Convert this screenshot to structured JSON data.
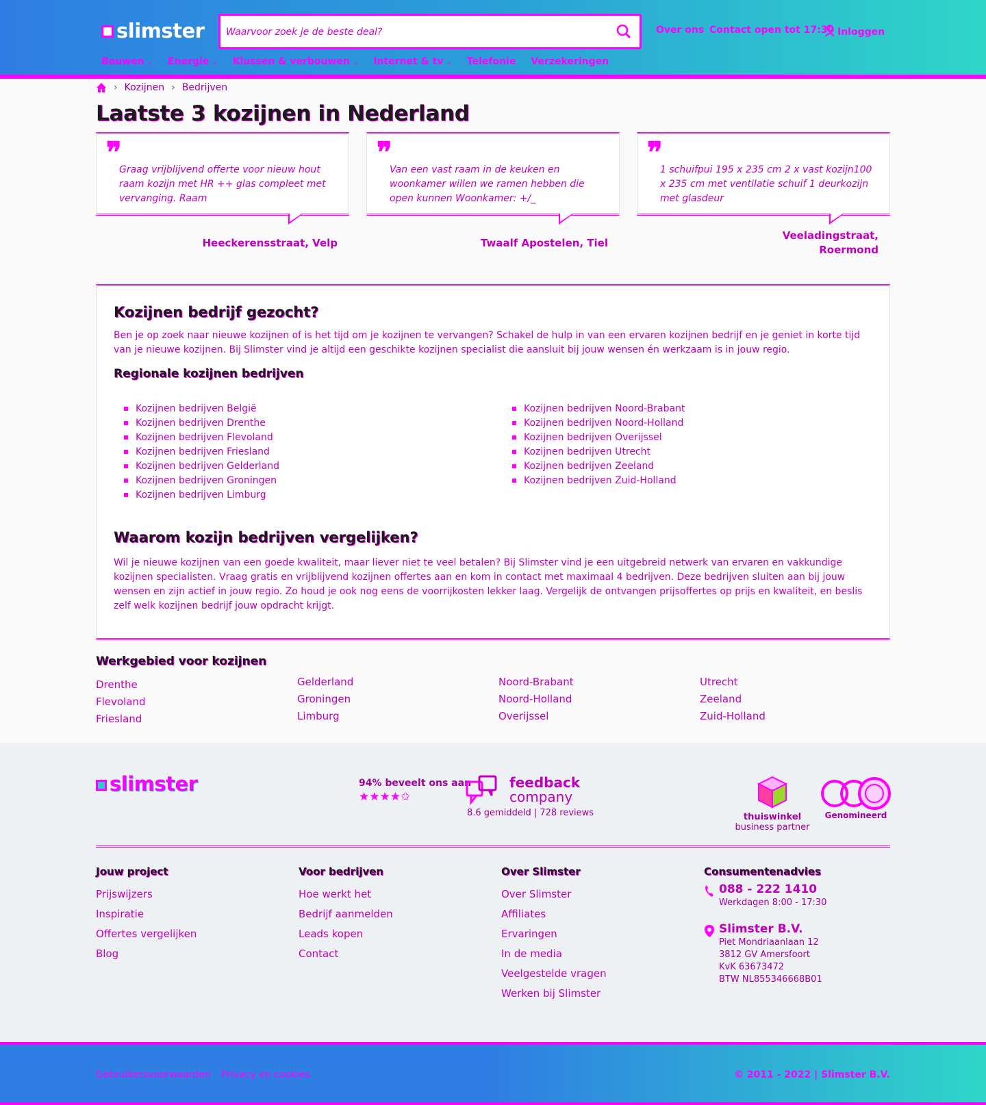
{
  "header": {
    "logo": "slimster",
    "search_placeholder": "Waarvoor zoek je de beste deal?",
    "links": {
      "about": "Over ons",
      "contact": "Contact open tot 17:30",
      "login": "Inloggen"
    },
    "nav": [
      "Bouwen",
      "Energie",
      "Klussen & verbouwen",
      "Internet & tv",
      "Telefonie",
      "Verzekeringen"
    ]
  },
  "breadcrumb": [
    "Kozijnen",
    "Bedrijven"
  ],
  "page_title": "Laatste 3 kozijnen in Nederland",
  "quotes": [
    {
      "text": "Graag vrijblijvend offerte voor nieuw hout raam kozijn met HR ++ glas compleet met vervanging. Raam",
      "location": "Heeckerensstraat, Velp"
    },
    {
      "text": "Van een vast raam in de keuken en woonkamer willen we ramen hebben die open kunnen Woonkamer: +/_",
      "location": "Twaalf Apostelen, Tiel"
    },
    {
      "text": "1 schuifpui 195 x 235 cm 2 x vast kozijn100 x 235 cm met ventilatie schuif 1 deurkozijn met glasdeur",
      "location": "Veeladingstraat, Roermond"
    }
  ],
  "info": {
    "h1": "Kozijnen bedrijf gezocht?",
    "p1": "Ben je op zoek naar nieuwe kozijnen of is het tijd om je kozijnen te vervangen? Schakel de hulp in van een ervaren kozijnen bedrijf en je geniet in korte tijd van je nieuwe kozijnen. Bij Slimster vind je altijd een geschikte kozijnen specialist die aansluit bij jouw wensen én werkzaam is in jouw regio.",
    "h_regional": "Regionale kozijnen bedrijven",
    "regions_left": [
      "Kozijnen bedrijven België",
      "Kozijnen bedrijven Drenthe",
      "Kozijnen bedrijven Flevoland",
      "Kozijnen bedrijven Friesland",
      "Kozijnen bedrijven Gelderland",
      "Kozijnen bedrijven Groningen",
      "Kozijnen bedrijven Limburg"
    ],
    "regions_right": [
      "Kozijnen bedrijven Noord-Brabant",
      "Kozijnen bedrijven Noord-Holland",
      "Kozijnen bedrijven Overijssel",
      "Kozijnen bedrijven Utrecht",
      "Kozijnen bedrijven Zeeland",
      "Kozijnen bedrijven Zuid-Holland"
    ],
    "h2": "Waarom kozijn bedrijven vergelijken?",
    "p2": "Wil je nieuwe kozijnen van een goede kwaliteit, maar liever niet te veel betalen? Bij Slimster vind je een uitgebreid netwerk van ervaren en vakkundige kozijnen specialisten. Vraag gratis en vrijblijvend kozijnen offertes aan en kom in contact met maximaal 4 bedrijven. Deze bedrijven sluiten aan bij jouw wensen en zijn actief in jouw regio. Zo houd je ook nog eens de voorrijkosten lekker laag. Vergelijk de ontvangen prijsoffertes op prijs en kwaliteit, en beslis zelf welk kozijnen bedrijf jouw opdracht krijgt."
  },
  "werkgebied": {
    "title": "Werkgebied voor kozijnen",
    "columns": [
      [
        "Drenthe",
        "Flevoland",
        "Friesland"
      ],
      [
        "Gelderland",
        "Groningen",
        "Limburg"
      ],
      [
        "Noord-Brabant",
        "Noord-Holland",
        "Overijssel"
      ],
      [
        "Utrecht",
        "Zeeland",
        "Zuid-Holland"
      ]
    ]
  },
  "footer": {
    "logo": "slimster",
    "rating_text": "94% beveelt ons aan",
    "stars": "★★★★✩",
    "feedback_line1": "feedback",
    "feedback_line2": "company",
    "feedback_score": "8.6 gemiddeld",
    "feedback_reviews": "728 reviews",
    "thuiswinkel_line1": "thuiswinkel",
    "thuiswinkel_line2": "business partner",
    "genomineerd": "Genomineerd",
    "cols": [
      {
        "title": "Jouw project",
        "links": [
          "Prijswijzers",
          "Inspiratie",
          "Offertes vergelijken",
          "Blog"
        ]
      },
      {
        "title": "Voor bedrijven",
        "links": [
          "Hoe werkt het",
          "Bedrijf aanmelden",
          "Leads kopen",
          "Contact"
        ]
      },
      {
        "title": "Over Slimster",
        "links": [
          "Over Slimster",
          "Affiliates",
          "Ervaringen",
          "In de media",
          "Veelgestelde vragen",
          "Werken bij Slimster"
        ]
      }
    ],
    "consumer": {
      "title": "Consumentenadvies",
      "phone": "088 - 222 1410",
      "hours": "Werkdagen 8:00 - 17:30",
      "company": "Slimster B.V.",
      "address1": "Piet Mondriaanlaan 12",
      "address2": "3812 GV Amersfoort",
      "kvk": "KvK 63673472",
      "btw": "BTW NL855346668B01"
    },
    "bottom": {
      "terms": "Gebruikersvoorwaarden",
      "privacy": "Privacy en cookies",
      "copyright": "© 2011 - 2022 | Slimster B.V."
    }
  },
  "colors": {
    "accent": "#ff00ff",
    "header_start": "#2f7ee3",
    "header_end": "#2fd6c8"
  }
}
